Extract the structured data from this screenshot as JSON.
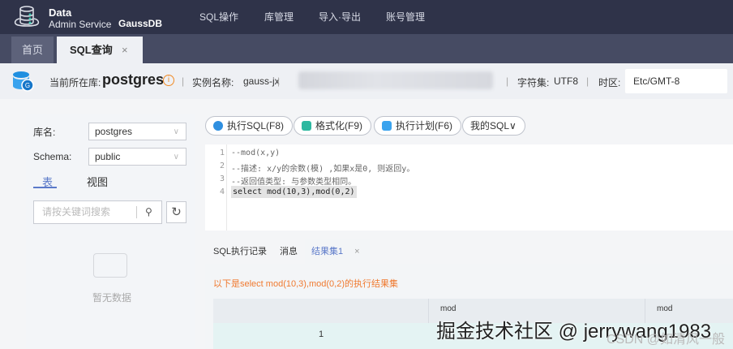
{
  "topbar": {
    "brand_line1": "Data",
    "brand_line2": "Admin Service",
    "brand_product": "GaussDB",
    "nav": [
      "SQL操作",
      "库管理",
      "导入·导出",
      "账号管理"
    ]
  },
  "tabs": {
    "home": "首页",
    "sql": "SQL查询",
    "close": "×"
  },
  "infobar": {
    "current_db_label": "当前所在库:",
    "current_db": "postgres",
    "info_icon": "i",
    "instance_label": "实例名称:",
    "instance": "gauss-jx",
    "charset_label": "字符集:",
    "charset": "UTF8",
    "tz_label": "时区:",
    "tz_value": "Etc/GMT-8"
  },
  "left": {
    "db_label": "库名:",
    "db_value": "postgres",
    "schema_label": "Schema:",
    "schema_value": "public",
    "tab_table": "表",
    "tab_view": "视图",
    "search_placeholder": "请按关键词搜索",
    "empty": "暂无数据"
  },
  "toolbar": {
    "run": "执行SQL(F8)",
    "format": "格式化(F9)",
    "plan": "执行计划(F6)",
    "mysql": "我的SQL∨"
  },
  "editor": {
    "lines": [
      "--mod(x,y)",
      "--描述: x/y的余数(模) ,如果x是0, 则返回y。",
      "--返回值类型: 与参数类型相同。",
      "select mod(10,3),mod(0,2)"
    ]
  },
  "result": {
    "tabs": [
      "SQL执行记录",
      "消息",
      "结果集1"
    ],
    "close": "×",
    "title": "以下是select mod(10,3),mod(0,2)的执行结果集",
    "columns": [
      "",
      "mod",
      "mod"
    ],
    "rows": [
      [
        "1",
        "1"
      ]
    ]
  },
  "watermark": {
    "main": "掘金技术社区 @ jerrywang1983",
    "csdn": "CSDN @如清风一般"
  },
  "colors": {
    "topbar": "#2f3349",
    "accent": "#5b79c9",
    "orange": "#f07a30"
  }
}
